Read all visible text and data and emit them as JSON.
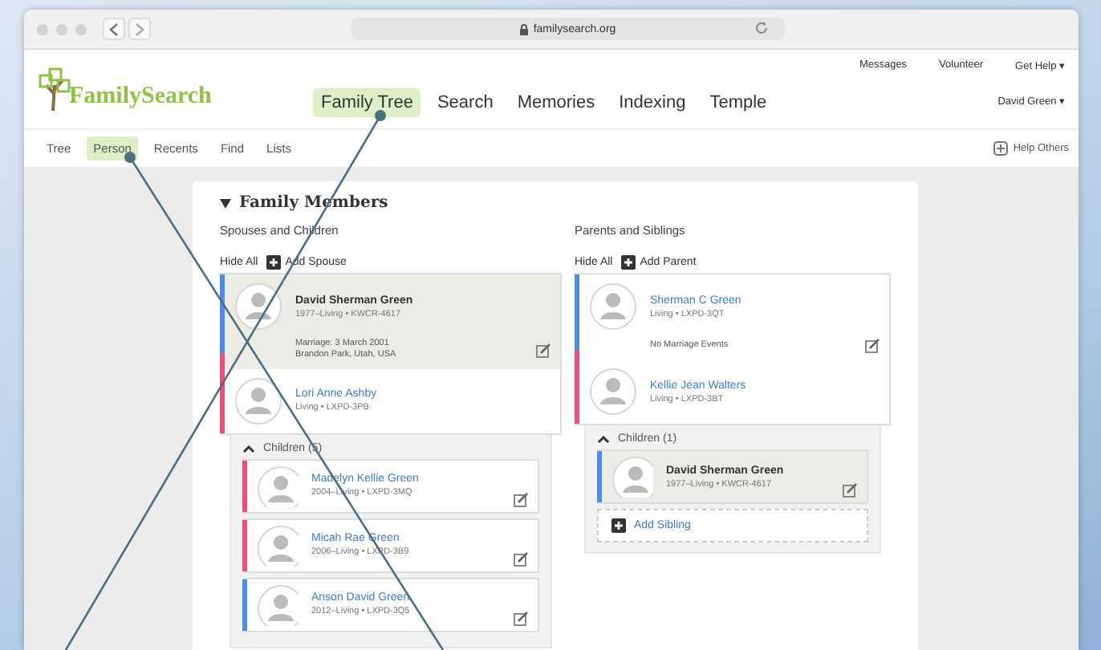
{
  "browser": {
    "address": "familysearch.org"
  },
  "header": {
    "logo": "FamilySearch",
    "nav": [
      {
        "label": "Family Tree",
        "selected": true
      },
      {
        "label": "Search",
        "selected": false
      },
      {
        "label": "Memories",
        "selected": false
      },
      {
        "label": "Indexing",
        "selected": false
      },
      {
        "label": "Temple",
        "selected": false
      }
    ],
    "top_links": [
      "Messages",
      "Volunteer",
      "Get Help ▾"
    ],
    "user": "David Green ▾"
  },
  "subnav": {
    "items": [
      {
        "label": "Tree",
        "selected": false
      },
      {
        "label": "Person",
        "selected": true
      },
      {
        "label": "Recents",
        "selected": false
      },
      {
        "label": "Find",
        "selected": false
      },
      {
        "label": "Lists",
        "selected": false
      }
    ],
    "help": "Help Others"
  },
  "family_members": {
    "title": "Family Members",
    "columns": [
      {
        "heading": "Spouses and Children",
        "hide": "Hide All",
        "add": "Add Spouse",
        "couple": [
          {
            "name": "David Sherman Green",
            "details": "1977–Living • KWCR-4617",
            "color": "#4d8ce8",
            "selected": true
          },
          {
            "name": "Lori Anne Ashby",
            "details": "Living • LXPD-3PB",
            "color": "#e8507a",
            "selected": false
          }
        ],
        "marriage": [
          "Marriage: 3 March 2001",
          "Brandon Park, Utah, USA"
        ],
        "children_label": "Children (5)",
        "children": [
          {
            "name": "Madelyn Kellie Green",
            "details": "2004–Living • LXPD-3MQ",
            "color": "#e8507a",
            "selected": false
          },
          {
            "name": "Micah Rae Green",
            "details": "2006–Living • LXPD-3B9",
            "color": "#e8507a",
            "selected": false
          },
          {
            "name": "Anson David Green",
            "details": "2012–Living • LXPD-3Q5",
            "color": "#4d8ce8",
            "selected": false
          }
        ]
      },
      {
        "heading": "Parents and Siblings",
        "hide": "Hide All",
        "add": "Add Parent",
        "couple": [
          {
            "name": "Sherman C Green",
            "details": "Living • LXPD-3QT",
            "color": "#4d8ce8",
            "selected": false
          },
          {
            "name": "Kellie Jean Walters",
            "details": "Living • LXPD-3BT",
            "color": "#e8507a",
            "selected": false
          }
        ],
        "marriage": [
          "No Marriage Events"
        ],
        "children_label": "Children (1)",
        "children": [
          {
            "name": "David Sherman Green",
            "details": "1977–Living • KWCR-4617",
            "color": "#4d8ce8",
            "selected": true
          }
        ],
        "add_child": "Add Sibling"
      }
    ]
  }
}
